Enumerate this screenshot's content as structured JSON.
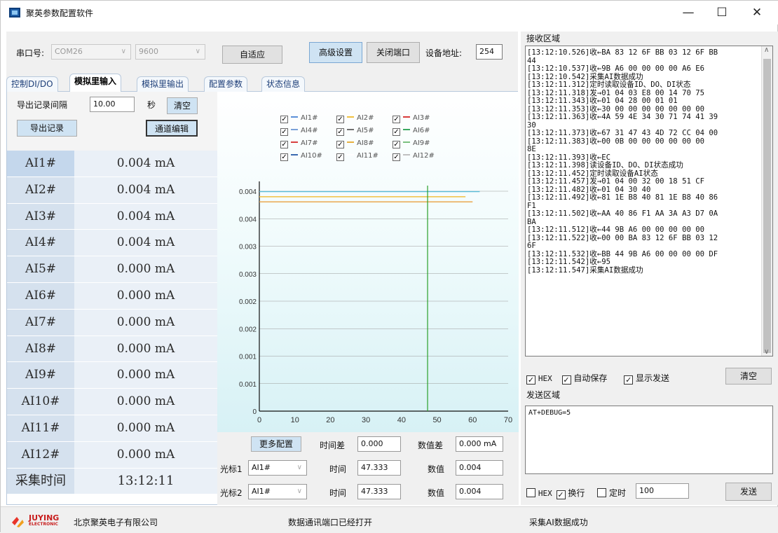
{
  "window": {
    "title": "聚英参数配置软件",
    "minimize_glyph": "—",
    "maximize_glyph": "☐",
    "close_glyph": "✕"
  },
  "toolbar": {
    "port_label": "串口号:",
    "port_value": "COM26",
    "baud_value": "9600",
    "auto_label": "自适应",
    "advanced_label": "高级设置",
    "close_port_label": "关闭端口",
    "addr_label": "设备地址:",
    "addr_value": "254"
  },
  "tabs": [
    "控制DI/DO",
    "模拟里输入",
    "模拟里输出",
    "配置参数",
    "状态信息"
  ],
  "active_tab": 1,
  "export": {
    "interval_label": "导出记录间隔",
    "interval_value": "10.00",
    "unit": "秒",
    "clear_label": "清空",
    "export_label": "导出记录",
    "edit_label": "通道编辑"
  },
  "ai_rows": [
    {
      "name": "AI1#",
      "value": "0.004 mA"
    },
    {
      "name": "AI2#",
      "value": "0.004 mA"
    },
    {
      "name": "AI3#",
      "value": "0.004 mA"
    },
    {
      "name": "AI4#",
      "value": "0.004 mA"
    },
    {
      "name": "AI5#",
      "value": "0.000 mA"
    },
    {
      "name": "AI6#",
      "value": "0.000 mA"
    },
    {
      "name": "AI7#",
      "value": "0.000 mA"
    },
    {
      "name": "AI8#",
      "value": "0.000 mA"
    },
    {
      "name": "AI9#",
      "value": "0.000 mA"
    },
    {
      "name": "AI10#",
      "value": "0.000 mA"
    },
    {
      "name": "AI11#",
      "value": "0.000 mA"
    },
    {
      "name": "AI12#",
      "value": "0.000 mA"
    }
  ],
  "acq_time": {
    "label": "采集时间",
    "value": "13:12:11"
  },
  "legend": [
    {
      "name": "AI1#",
      "color": "#5a8fd8"
    },
    {
      "name": "AI2#",
      "color": "#f0c040"
    },
    {
      "name": "AI3#",
      "color": "#d83a3a"
    },
    {
      "name": "AI4#",
      "color": "#7aa0d8"
    },
    {
      "name": "AI5#",
      "color": "#707070"
    },
    {
      "name": "AI6#",
      "color": "#3aa860"
    },
    {
      "name": "AI7#",
      "color": "#d84040"
    },
    {
      "name": "AI8#",
      "color": "#e8b040"
    },
    {
      "name": "AI9#",
      "color": "#7cc080"
    },
    {
      "name": "AI10#",
      "color": "#3a6ab0"
    },
    {
      "name": "AI11#",
      "color": "#ffffff"
    },
    {
      "name": "AI12#",
      "color": "#c0c0c0"
    }
  ],
  "chart_data": {
    "type": "line",
    "x_ticks": [
      "0",
      "10",
      "20",
      "30",
      "40",
      "50",
      "60",
      "70"
    ],
    "y_ticks": [
      "0",
      "0.001",
      "0.001",
      "0.002",
      "0.002",
      "0.003",
      "0.003",
      "0.004",
      "0.004"
    ],
    "xlim": [
      0,
      70
    ],
    "ylim": [
      0,
      0.0045
    ],
    "series": [
      {
        "name": "AI1#",
        "color": "#5abcd8",
        "values": [
          [
            0,
            0.0043
          ],
          [
            62,
            0.0043
          ]
        ]
      },
      {
        "name": "AI2#",
        "color": "#f0c040",
        "values": [
          [
            0,
            0.0042
          ],
          [
            58,
            0.0042
          ]
        ]
      },
      {
        "name": "AI3#",
        "color": "#e8a040",
        "values": [
          [
            0,
            0.0041
          ],
          [
            60,
            0.0041
          ]
        ]
      }
    ],
    "cursor_x": 47.333
  },
  "cursor": {
    "more_label": "更多配置",
    "timediff_label": "时间差",
    "timediff_value": "0.000",
    "valdiff_label": "数值差",
    "valdiff_value": "0.000 mA",
    "c1_label": "光标1",
    "c1_channel": "AI1#",
    "c1_time_label": "时间",
    "c1_time": "47.333",
    "c1_val_label": "数值",
    "c1_val": "0.004",
    "c2_label": "光标2",
    "c2_channel": "AI1#",
    "c2_time_label": "时间",
    "c2_time": "47.333",
    "c2_val_label": "数值",
    "c2_val": "0.004"
  },
  "rx": {
    "title": "接收区域",
    "lines": [
      "[13:12:10.526]收←BA 83 12 6F BB 03 12 6F BB",
      "44",
      "[13:12:10.537]收←9B A6 00 00 00 00 A6 E6",
      "[13:12:10.542]采集AI数据成功",
      "[13:12:11.312]定时读取设备ID、DO、DI状态",
      "[13:12:11.318]发→01 04 03 E8 00 14 70 75",
      "[13:12:11.343]收←01 04 28 00 01 01",
      "[13:12:11.353]收←30 00 00 00 00 00 00 00",
      "[13:12:11.363]收←4A 59 4E 34 30 71 74 41 39",
      "30",
      "[13:12:11.373]收←67 31 47 43 4D 72 CC 04 00",
      "[13:12:11.383]收←00 0B 00 00 00 00 00 00",
      "8E",
      "[13:12:11.393]收←EC",
      "[13:12:11.398]读设备ID、DO、DI状态成功",
      "[13:12:11.452]定时读取设备AI状态",
      "[13:12:11.457]发→01 04 00 32 00 18 51 CF",
      "[13:12:11.482]收←01 04 30 40",
      "[13:12:11.492]收←81 1E B8 40 81 1E B8 40 86",
      "F1",
      "[13:12:11.502]收←AA 40 86 F1 AA 3A A3 D7 0A",
      "BA",
      "[13:12:11.512]收←44 9B A6 00 00 00 00 00",
      "[13:12:11.522]收←00 00 BA 83 12 6F BB 03 12",
      "6F",
      "[13:12:11.532]收←BB 44 9B A6 00 00 00 00 DF",
      "[13:12:11.542]收←95",
      "[13:12:11.547]采集AI数据成功"
    ],
    "hex_label": "HEX",
    "autosave_label": "自动保存",
    "showsend_label": "显示发送",
    "clear_label": "清空"
  },
  "tx": {
    "title": "发送区域",
    "content": "AT+DEBUG=5",
    "hex_label": "HEX",
    "newline_label": "换行",
    "timer_label": "定时",
    "timer_value": "100",
    "send_label": "发送"
  },
  "status": {
    "brand": "JUYING",
    "brand_sub": "ELECTRONIC",
    "company": "北京聚英电子有限公司",
    "port_status": "数据通讯端口已经打开",
    "msg": "采集AI数据成功"
  }
}
